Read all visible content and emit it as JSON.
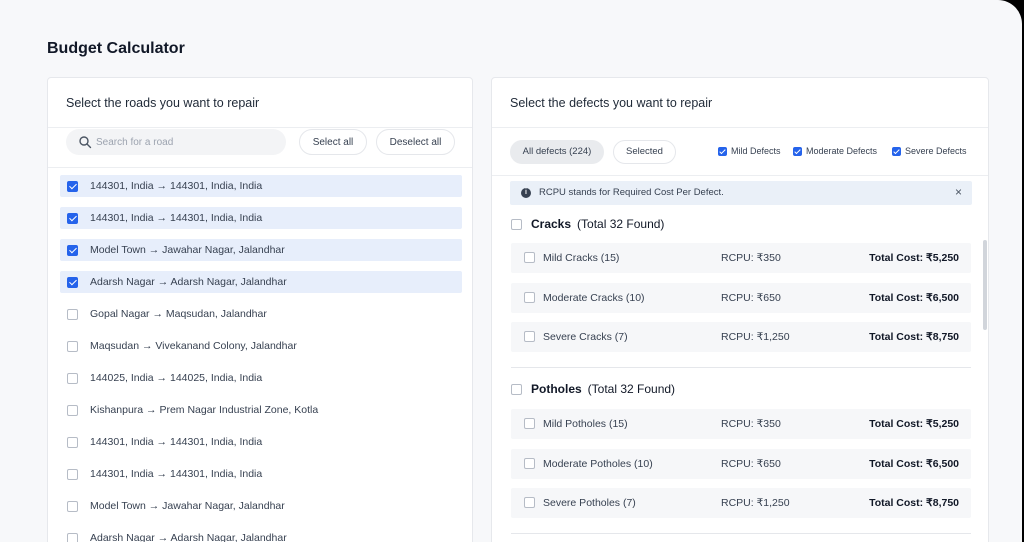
{
  "page": {
    "title": "Budget Calculator"
  },
  "roads_panel": {
    "heading": "Select the roads you want to repair",
    "search_placeholder": "Search for a road",
    "select_all_label": "Select all",
    "deselect_all_label": "Deselect all",
    "roads": [
      {
        "label": "144301, India → 144301, India, India",
        "selected": true
      },
      {
        "label": "144301, India → 144301, India, India",
        "selected": true
      },
      {
        "label": "Model Town → Jawahar Nagar, Jalandhar",
        "selected": true
      },
      {
        "label": "Adarsh Nagar → Adarsh Nagar, Jalandhar",
        "selected": true
      },
      {
        "label": "Gopal Nagar → Maqsudan, Jalandhar",
        "selected": false
      },
      {
        "label": "Maqsudan → Vivekanand Colony, Jalandhar",
        "selected": false
      },
      {
        "label": "144025, India → 144025, India, India",
        "selected": false
      },
      {
        "label": "Kishanpura → Prem Nagar Industrial Zone, Kotla",
        "selected": false
      },
      {
        "label": "144301, India → 144301, India, India",
        "selected": false
      },
      {
        "label": "144301, India → 144301, India, India",
        "selected": false
      },
      {
        "label": "Model Town → Jawahar Nagar, Jalandhar",
        "selected": false
      },
      {
        "label": "Adarsh Nagar → Adarsh Nagar, Jalandhar",
        "selected": false
      }
    ]
  },
  "defects_panel": {
    "heading": "Select the defects you want to repair",
    "tabs": {
      "all": "All defects (224)",
      "selected": "Selected"
    },
    "filters": [
      {
        "label": "Mild Defects",
        "checked": true
      },
      {
        "label": "Moderate Defects",
        "checked": true
      },
      {
        "label": "Severe Defects",
        "checked": true
      }
    ],
    "info_text": "RCPU stands for Required Cost Per Defect.",
    "info_close": "×",
    "groups": [
      {
        "name": "Cracks",
        "total": "(Total 32 Found)",
        "rows": [
          {
            "name": "Mild Cracks (15)",
            "rcpu": "RCPU: ₹350",
            "total": "Total Cost: ₹5,250"
          },
          {
            "name": "Moderate Cracks (10)",
            "rcpu": "RCPU: ₹650",
            "total": "Total Cost: ₹6,500"
          },
          {
            "name": "Severe Cracks (7)",
            "rcpu": "RCPU: ₹1,250",
            "total": "Total Cost: ₹8,750"
          }
        ]
      },
      {
        "name": "Potholes",
        "total": "(Total 32 Found)",
        "rows": [
          {
            "name": "Mild Potholes (15)",
            "rcpu": "RCPU: ₹350",
            "total": "Total Cost: ₹5,250"
          },
          {
            "name": "Moderate Potholes (10)",
            "rcpu": "RCPU: ₹650",
            "total": "Total Cost: ₹6,500"
          },
          {
            "name": "Severe Potholes (7)",
            "rcpu": "RCPU: ₹1,250",
            "total": "Total Cost: ₹8,750"
          }
        ]
      }
    ]
  },
  "colors": {
    "accent": "#2563eb",
    "selected_row_bg": "#e7eefb",
    "info_bg": "#eaf0f8"
  }
}
